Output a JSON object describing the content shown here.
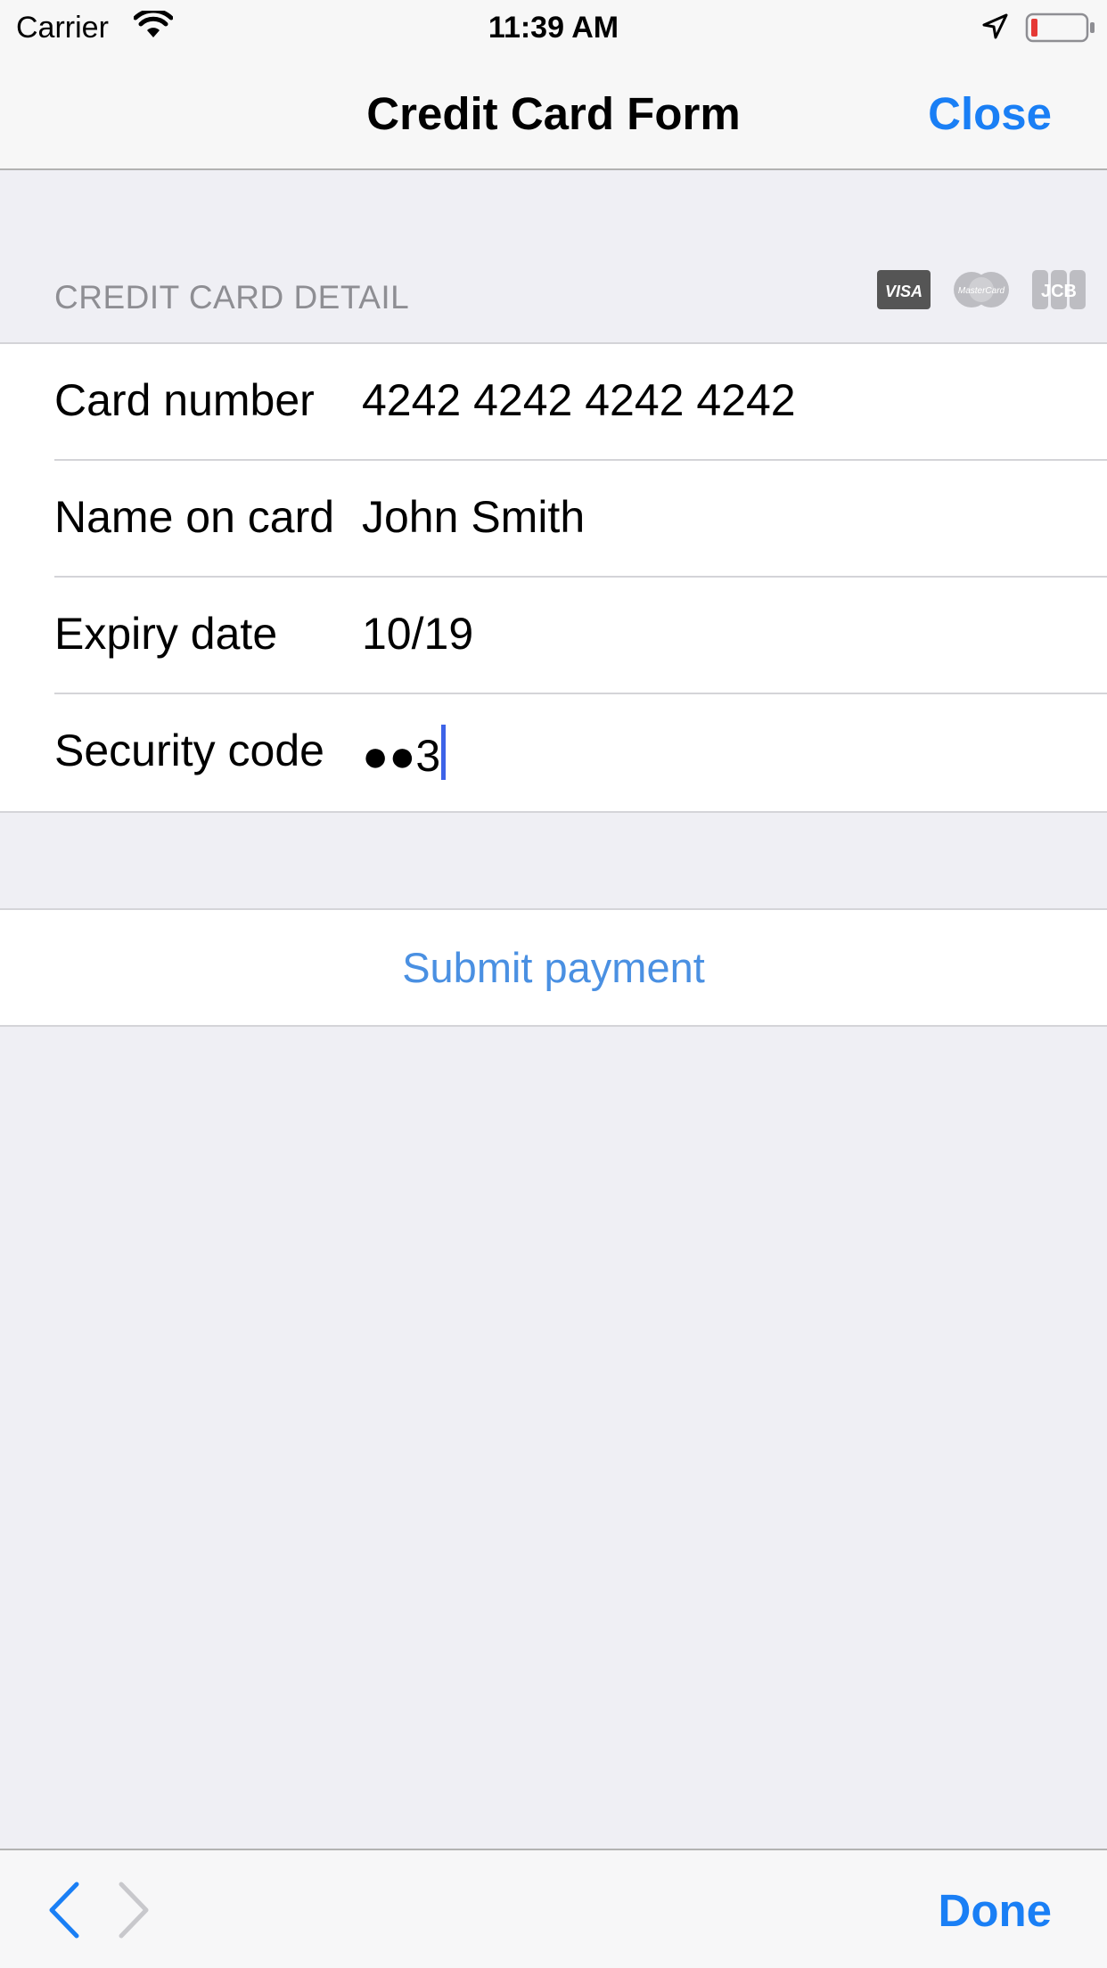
{
  "status_bar": {
    "carrier": "Carrier",
    "time": "11:39 AM"
  },
  "nav": {
    "title": "Credit Card Form",
    "close_label": "Close"
  },
  "section": {
    "title": "CREDIT CARD DETAIL",
    "card_logos": [
      "VISA",
      "MasterCard",
      "JCB"
    ]
  },
  "form": {
    "rows": [
      {
        "label": "Card number",
        "value": "4242 4242 4242 4242"
      },
      {
        "label": "Name on card",
        "value": "John Smith"
      },
      {
        "label": "Expiry date",
        "value": "10/19"
      },
      {
        "label": "Security code",
        "value": "●●3"
      }
    ]
  },
  "submit": {
    "label": "Submit payment"
  },
  "toolbar": {
    "done_label": "Done"
  },
  "colors": {
    "accent": "#1a7ff5",
    "submit_text": "#4a90e2",
    "section_text": "#8e8e93",
    "background": "#efeff4",
    "caret": "#3d63e8",
    "battery_low": "#e53935"
  },
  "icons": {
    "wifi": "wifi-icon",
    "location": "location-arrow-icon",
    "battery": "battery-icon",
    "prev": "chevron-left-icon",
    "next": "chevron-right-icon"
  }
}
